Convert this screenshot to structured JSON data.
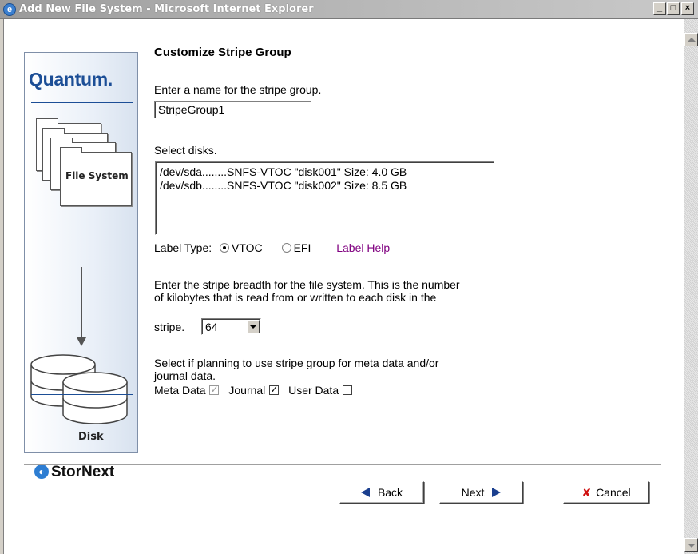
{
  "window": {
    "title": "Add New File System - Microsoft Internet Explorer",
    "minimize_glyph": "_",
    "maximize_glyph": "□",
    "close_glyph": "×"
  },
  "side_panel": {
    "brand": "Quantum.",
    "folder_label": "File System",
    "disk_label": "Disk",
    "product": "StorNext",
    "product_icon": "stornext-logo-icon"
  },
  "form": {
    "title": "Customize Stripe Group",
    "name_prompt": "Enter a name for the stripe group.",
    "name_value": "StripeGroup1",
    "disks_prompt": "Select disks.",
    "disks": [
      "/dev/sda........SNFS-VTOC \"disk001\" Size: 4.0 GB",
      "/dev/sdb........SNFS-VTOC \"disk002\" Size: 8.5 GB"
    ],
    "label_type_label": "Label Type:",
    "label_type_options": [
      "VTOC",
      "EFI"
    ],
    "label_type_selected": "VTOC",
    "label_help": "Label Help",
    "stripe_text_1": "Enter the stripe breadth for the file system. This is the number",
    "stripe_text_2": "of kilobytes that is read from or written to each disk in the",
    "stripe_text_3": "stripe.",
    "stripe_breadth": "64",
    "usage_text_1": "Select if planning to use stripe group for meta data and/or",
    "usage_text_2": "journal data.",
    "meta_data_label": "Meta Data",
    "meta_data_checked": true,
    "journal_label": "Journal",
    "journal_checked": true,
    "user_data_label": "User Data",
    "user_data_checked": false
  },
  "buttons": {
    "back": "Back",
    "next": "Next",
    "cancel": "Cancel"
  },
  "colors": {
    "brand_blue": "#1c4e96",
    "link_visited": "#800080",
    "cancel_x": "#d01010"
  }
}
